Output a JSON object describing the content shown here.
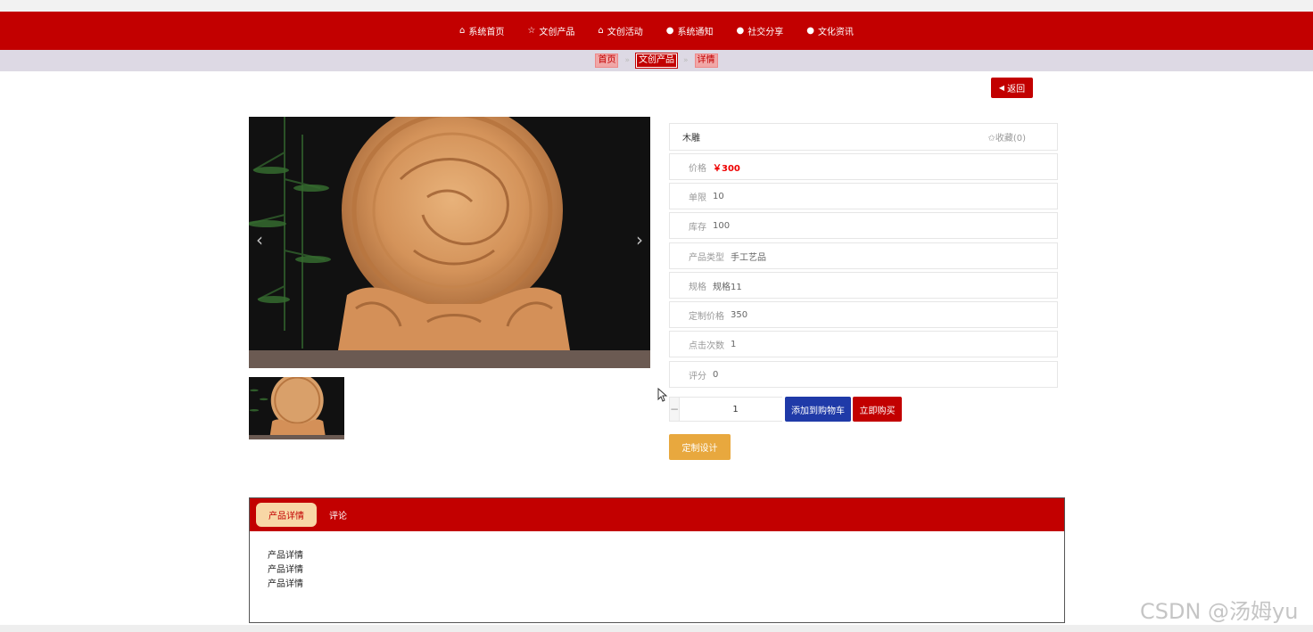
{
  "nav": {
    "items": [
      {
        "icon": "home-icon",
        "label": "系统首页"
      },
      {
        "icon": "star-icon",
        "label": "文创产品"
      },
      {
        "icon": "bag-icon",
        "label": "文创活动"
      },
      {
        "icon": "dot-icon",
        "label": "系统通知"
      },
      {
        "icon": "dot-icon",
        "label": "社交分享"
      },
      {
        "icon": "info-icon",
        "label": "文化资讯"
      }
    ]
  },
  "breadcrumb": {
    "home": "首页",
    "category": "文创产品",
    "current": "详情",
    "separator": "»"
  },
  "back_button": "返回",
  "product": {
    "name": "木雕",
    "favorite": "✩收藏(0)",
    "fields": [
      {
        "label": "价格",
        "value": "￥300",
        "highlight": true
      },
      {
        "label": "单限",
        "value": "10"
      },
      {
        "label": "库存",
        "value": "100"
      },
      {
        "label": "产品类型",
        "value": "手工艺品"
      },
      {
        "label": "规格",
        "value": "规格11"
      },
      {
        "label": "定制价格",
        "value": "350"
      },
      {
        "label": "点击次数",
        "value": "1"
      },
      {
        "label": "评分",
        "value": "0"
      }
    ]
  },
  "quantity": {
    "minus": "−",
    "value": "1",
    "plus": "+"
  },
  "actions": {
    "add_to_cart": "添加到购物车",
    "buy_now": "立即购买",
    "custom_design": "定制设计"
  },
  "tabs": {
    "items": [
      "产品详情",
      "评论"
    ],
    "content_lines": [
      "产品详情",
      "产品详情",
      "产品详情"
    ]
  },
  "watermark": "CSDN @汤姆yu",
  "colors": {
    "primary_red": "#c20000",
    "cart_blue": "#1f3aa8",
    "custom_orange": "#e8a83e",
    "price_red": "#e00000",
    "tab_active_bg": "#f8d7a6"
  }
}
